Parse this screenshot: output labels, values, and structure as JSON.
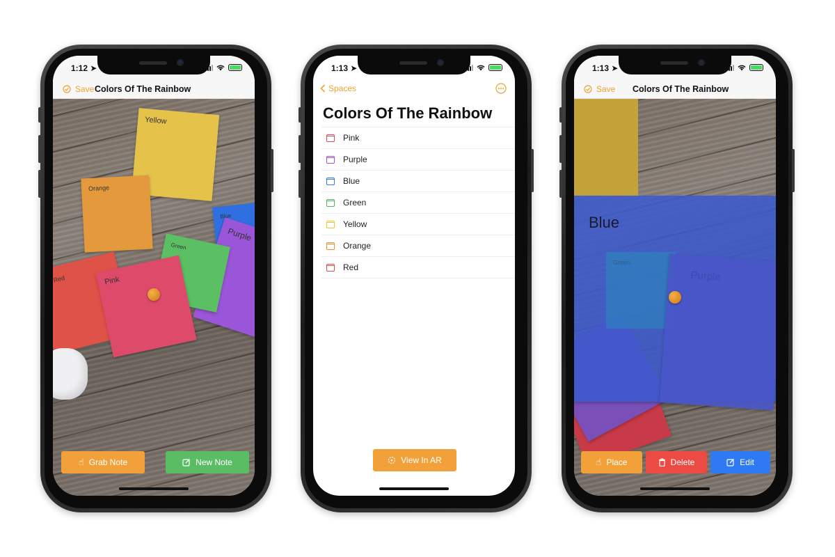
{
  "colors": {
    "accent": "#f2a13a",
    "green": "#5bbd63",
    "red": "#ec4b43",
    "blue": "#2f79f2"
  },
  "phone1": {
    "status": {
      "time": "1:12 ➤"
    },
    "nav": {
      "save_label": "Save",
      "title": "Colors Of The Rainbow"
    },
    "notes": [
      {
        "label": "Yellow",
        "color": "#e5c34a"
      },
      {
        "label": "Orange",
        "color": "#e49a3c"
      },
      {
        "label": "Blue",
        "color": "#2f6fe0"
      },
      {
        "label": "Purple",
        "color": "#9a55d8"
      },
      {
        "label": "Green",
        "color": "#5bbf64"
      },
      {
        "label": "Red",
        "color": "#df5247"
      },
      {
        "label": "Pink",
        "color": "#de4a6a"
      }
    ],
    "buttons": {
      "grab_note": "Grab Note",
      "new_note": "New Note"
    }
  },
  "phone2": {
    "status": {
      "time": "1:13 ➤"
    },
    "nav": {
      "back_label": "Spaces"
    },
    "title": "Colors Of The Rainbow",
    "items": [
      {
        "label": "Pink",
        "color": "#e2485e"
      },
      {
        "label": "Purple",
        "color": "#a24fe0"
      },
      {
        "label": "Blue",
        "color": "#2f79f2"
      },
      {
        "label": "Green",
        "color": "#4cb85a"
      },
      {
        "label": "Yellow",
        "color": "#f2c230"
      },
      {
        "label": "Orange",
        "color": "#f08c2a"
      },
      {
        "label": "Red",
        "color": "#ea4a3f"
      }
    ],
    "view_ar_label": "View In AR"
  },
  "phone3": {
    "status": {
      "time": "1:13 ➤"
    },
    "nav": {
      "save_label": "Save",
      "title": "Colors Of The Rainbow"
    },
    "notes": [
      {
        "label": "Blue"
      },
      {
        "label": "Green"
      },
      {
        "label": "Purple"
      }
    ],
    "buttons": {
      "place": "Place",
      "delete": "Delete",
      "edit": "Edit"
    }
  }
}
